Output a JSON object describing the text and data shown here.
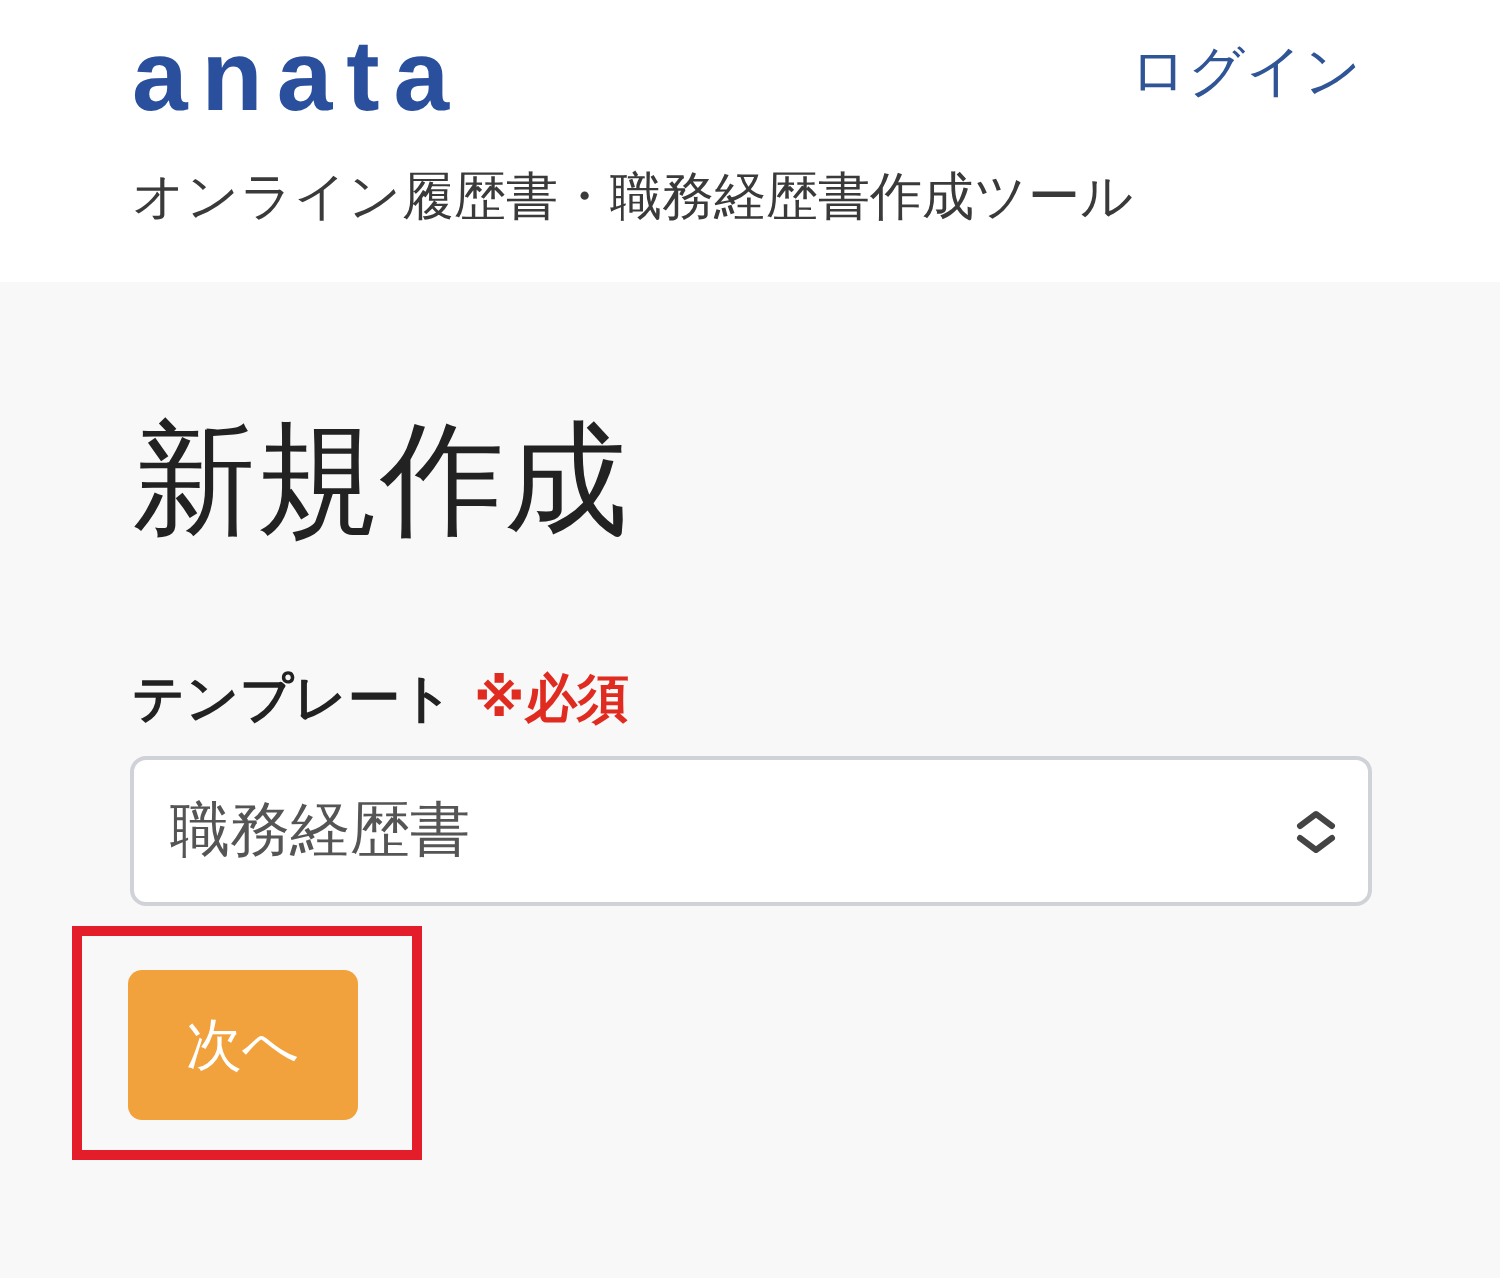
{
  "header": {
    "logo": "anata",
    "login_link": "ログイン",
    "tagline": "オンライン履歴書・職務経歴書作成ツール"
  },
  "page": {
    "title": "新規作成"
  },
  "form": {
    "template_field": {
      "label": "テンプレート",
      "required_mark": "※必須",
      "value": "職務経歴書"
    }
  },
  "actions": {
    "next_button": "次へ",
    "highlighted": true
  }
}
